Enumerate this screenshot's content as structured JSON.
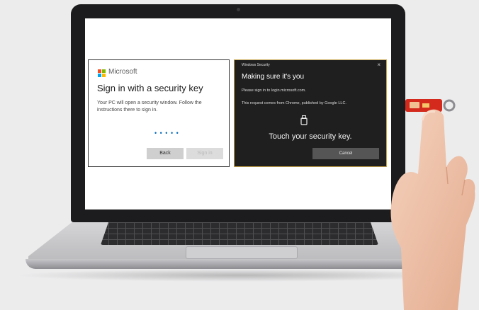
{
  "left_dialog": {
    "brand": "Microsoft",
    "title": "Sign in with a security key",
    "body": "Your PC will open a security window. Follow the instructions there to sign in.",
    "progress": "• • • • •",
    "back_label": "Back",
    "next_label": "Sign in"
  },
  "right_dialog": {
    "window_title": "Windows Security",
    "close_glyph": "×",
    "heading": "Making sure it's you",
    "line1": "Please sign in to login.microsoft.com.",
    "line2": "This request comes from Chrome, published by Google LLC.",
    "touch_text": "Touch your security key.",
    "cancel_label": "Cancel"
  },
  "colors": {
    "ms_red": "#f25022",
    "ms_green": "#7fba00",
    "ms_blue": "#00a4ef",
    "ms_yellow": "#ffb900",
    "key_red": "#d42a1e",
    "frame_gold": "#c9a64a"
  },
  "icons": [
    "microsoft-logo-icon",
    "close-icon",
    "security-key-icon"
  ]
}
